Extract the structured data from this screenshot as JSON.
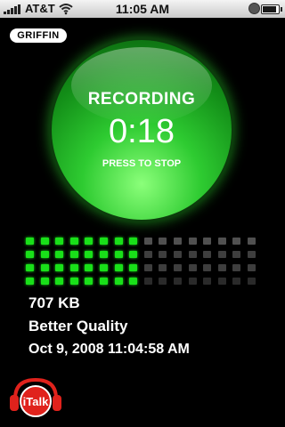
{
  "status_bar": {
    "carrier": "AT&T",
    "time": "11:05 AM",
    "battery_level": 0.9
  },
  "brand": {
    "logo_text": "GRIFFIN"
  },
  "recorder": {
    "state": "RECORDING",
    "elapsed": "0:18",
    "prompt": "PRESS TO STOP",
    "level": {
      "lit_columns": 8,
      "total_columns": 16,
      "rows": 4
    }
  },
  "recording_info": {
    "size": "707 KB",
    "quality": "Better Quality",
    "timestamp": "Oct 9, 2008 11:04:58 AM"
  },
  "app_logo": {
    "text": "iTalk"
  },
  "colors": {
    "accent_green": "#19e019",
    "button_green": "#2ecb31",
    "logo_red": "#e0221c"
  }
}
